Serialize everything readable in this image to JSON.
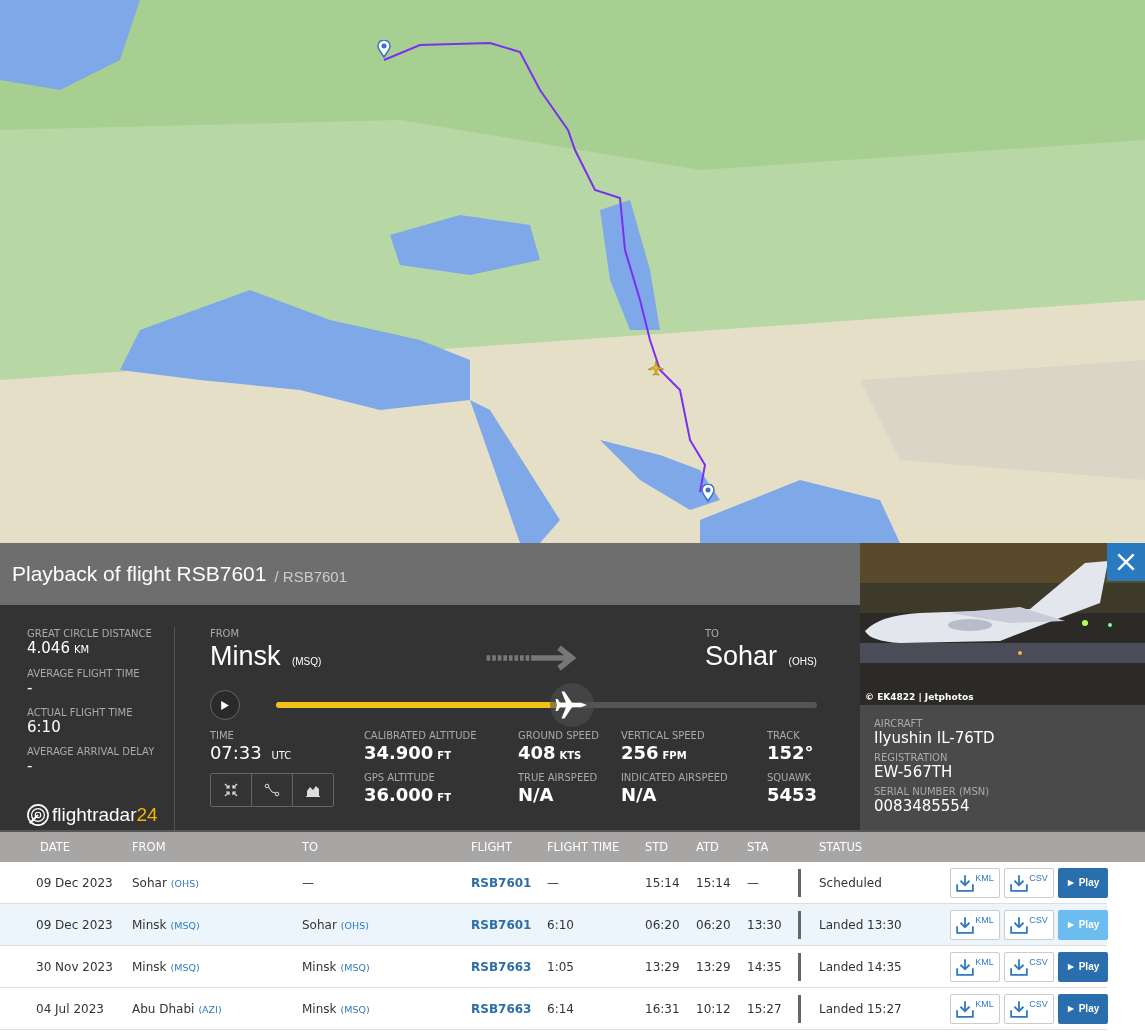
{
  "panel": {
    "title": "Playback of flight RSB7601",
    "subtitle": "/ RSB7601",
    "stats": [
      {
        "label": "GREAT CIRCLE DISTANCE",
        "value": "4.046",
        "unit": "KM"
      },
      {
        "label": "AVERAGE FLIGHT TIME",
        "value": "-"
      },
      {
        "label": "ACTUAL FLIGHT TIME",
        "value": "6:10"
      },
      {
        "label": "AVERAGE ARRIVAL DELAY",
        "value": "-"
      }
    ],
    "logo": {
      "text": "flightradar",
      "accent": "24"
    },
    "from": {
      "label": "FROM",
      "city": "Minsk",
      "code": "(MSQ)"
    },
    "to": {
      "label": "TO",
      "city": "Sohar",
      "code": "(OHS)"
    },
    "progress": {
      "level": 0.55
    },
    "time": {
      "label": "TIME",
      "value": "07:33",
      "unit": "UTC"
    },
    "metrics": [
      {
        "label": "CALIBRATED ALTITUDE",
        "value": "34.900",
        "unit": "FT"
      },
      {
        "label": "GROUND SPEED",
        "value": "408",
        "unit": "KTS"
      },
      {
        "label": "VERTICAL SPEED",
        "value": "256",
        "unit": "FPM"
      },
      {
        "label": "TRACK",
        "value": "152°"
      },
      {
        "label": "GPS ALTITUDE",
        "value": "36.000",
        "unit": "FT"
      },
      {
        "label": "TRUE AIRSPEED",
        "value": "N/A"
      },
      {
        "label": "INDICATED AIRSPEED",
        "value": "N/A"
      },
      {
        "label": "SQUAWK",
        "value": "5453"
      }
    ]
  },
  "photo": {
    "kind": "picture",
    "credit": "© EK4822 | Jetphotos"
  },
  "aircraft": [
    {
      "label": "AIRCRAFT",
      "value": "Ilyushin IL-76TD"
    },
    {
      "label": "REGISTRATION",
      "value": "EW-567TH"
    },
    {
      "label": "SERIAL NUMBER (MSN)",
      "value": "0083485554"
    }
  ],
  "table": {
    "columns": [
      "DATE",
      "FROM",
      "TO",
      "FLIGHT",
      "FLIGHT TIME",
      "STD",
      "ATD",
      "STA",
      "STATUS"
    ],
    "rows": [
      {
        "date": "09 Dec 2023",
        "from": {
          "city": "Sohar",
          "code": "(OHS)"
        },
        "to": {
          "city": "—"
        },
        "flight": "RSB7601",
        "flight_time": "—",
        "std": "15:14",
        "atd": "15:14",
        "sta": "—",
        "status": "Scheduled",
        "buttons": [
          "KML",
          "CSV",
          "Play"
        ],
        "selected": false
      },
      {
        "date": "09 Dec 2023",
        "from": {
          "city": "Minsk",
          "code": "(MSQ)"
        },
        "to": {
          "city": "Sohar",
          "code": "(OHS)"
        },
        "flight": "RSB7601",
        "flight_time": "6:10",
        "std": "06:20",
        "atd": "06:20",
        "sta": "13:30",
        "status": "Landed 13:30",
        "buttons": [
          "KML",
          "CSV",
          "Play"
        ],
        "selected": true
      },
      {
        "date": "30 Nov 2023",
        "from": {
          "city": "Minsk",
          "code": "(MSQ)"
        },
        "to": {
          "city": "Minsk",
          "code": "(MSQ)"
        },
        "flight": "RSB7663",
        "flight_time": "1:05",
        "std": "13:29",
        "atd": "13:29",
        "sta": "14:35",
        "status": "Landed 14:35",
        "buttons": [
          "KML",
          "CSV",
          "Play"
        ],
        "selected": false
      },
      {
        "date": "04 Jul 2023",
        "from": {
          "city": "Abu Dhabi",
          "code": "(AZI)"
        },
        "to": {
          "city": "Minsk",
          "code": "(MSQ)"
        },
        "flight": "RSB7663",
        "flight_time": "6:14",
        "std": "16:31",
        "atd": "10:12",
        "sta": "15:27",
        "status": "Landed 15:27",
        "buttons": [
          "KML",
          "CSV",
          "Play"
        ],
        "selected": false
      }
    ]
  }
}
